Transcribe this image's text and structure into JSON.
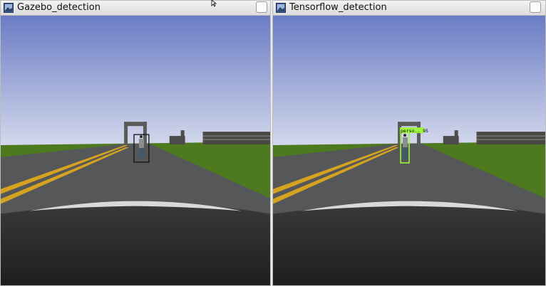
{
  "windows": [
    {
      "title": "Gazebo_detection",
      "icon": "image-viewer-icon"
    },
    {
      "title": "Tensorflow_detection",
      "icon": "image-viewer-icon",
      "detection_label": "perso.. 95"
    }
  ],
  "colors": {
    "sky_top": "#6e7fc5",
    "sky_bottom": "#d2d8ec",
    "grass": "#4e7a1f",
    "road": "#545657",
    "lane_line": "#d6a320",
    "hood": "#2e2e2e",
    "gazebo_box": "#111111",
    "tf_box": "#9ef53b"
  },
  "cursor_icon": "mouse-pointer-icon"
}
